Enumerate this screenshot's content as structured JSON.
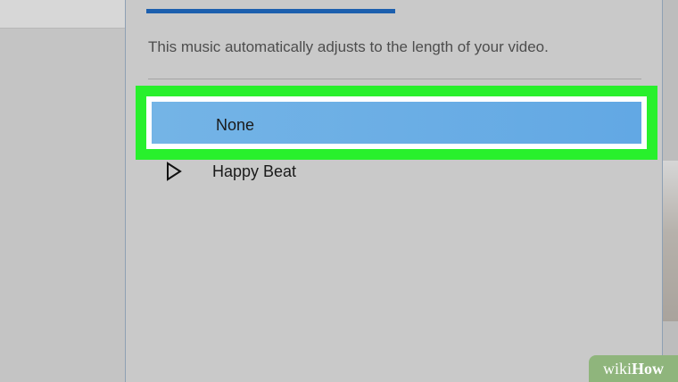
{
  "panel": {
    "description": "This music automatically adjusts to the length of your video.",
    "options": [
      {
        "label": "None",
        "selected": true
      },
      {
        "label": "Happy Beat",
        "selected": false,
        "icon": "play-icon"
      }
    ]
  },
  "colors": {
    "tab_indicator": "#1c5fae",
    "selected_bg": "#68acE5",
    "highlight": "#28f02c"
  },
  "watermark": {
    "wiki": "wiki",
    "how": "How"
  }
}
